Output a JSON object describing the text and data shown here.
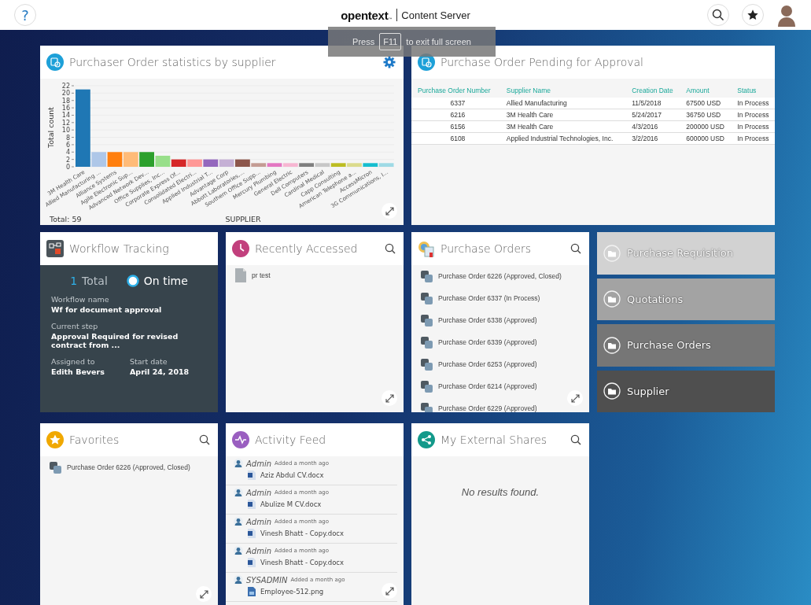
{
  "header": {
    "help": "?",
    "logo": "opentext",
    "trademark": "™",
    "product": "Content Server"
  },
  "fullscreen_notice": {
    "before": "Press",
    "key": "F11",
    "after": "to exit full screen"
  },
  "tiles": [
    {
      "kind": "chart",
      "title": "Purchaser Order statistics by supplier",
      "expand": true,
      "total": "Total: 59",
      "chart_data": {
        "type": "bar",
        "grid": true,
        "xlabel": "SUPPLIER",
        "ylabel": "Total count",
        "ylim": [
          0,
          22
        ],
        "yticks": [
          0,
          2,
          4,
          6,
          8,
          10,
          12,
          14,
          16,
          18,
          20,
          22
        ],
        "categories": [
          "3M Health Care",
          "Allied Manufacturing ...",
          "Alliance Systems",
          "Agile Electronic Sup...",
          "Advanced Network Dev...",
          "Office Supplies, Inc...",
          "Corporate Express Of...",
          "Consolidated Electri...",
          "Applied Industrial T...",
          "Advantage Corp",
          "Abbott Laboratories,...",
          "Southern Office Supp...",
          "Mercury Plumbing",
          "General Electric",
          "Dell Computers",
          "Cardinal Medical",
          "Capp Consulting",
          "American Telephone a...",
          "AccessMicron",
          "3G Communications, I..."
        ],
        "values": [
          21,
          4,
          4,
          4,
          4,
          3,
          2,
          2,
          2,
          2,
          2,
          1,
          1,
          1,
          1,
          1,
          1,
          1,
          1,
          1
        ]
      }
    },
    {
      "kind": "table",
      "title": "Purchase Order Pending for Approval",
      "columns": [
        "Purchase Order Number",
        "Supplier Name",
        "Creation Date",
        "Amount",
        "Status"
      ],
      "rows": [
        [
          "6337",
          "Allied Manufacturing",
          "11/5/2018",
          "67500 USD",
          "In Process"
        ],
        [
          "6216",
          "3M Health Care",
          "5/24/2017",
          "36750 USD",
          "In Process"
        ],
        [
          "6156",
          "3M Health Care",
          "4/3/2016",
          "200000 USD",
          "In Process"
        ],
        [
          "6108",
          "Applied Industrial Technologies, Inc.",
          "3/2/2016",
          "600000 USD",
          "In Process"
        ]
      ]
    },
    {
      "kind": "workflow",
      "title": "Workflow Tracking",
      "count": "1",
      "count_label": "Total",
      "status": "On time",
      "fields": [
        {
          "label": "Workflow name",
          "value": "Wf for document approval"
        },
        {
          "label": "Current step",
          "value": "Approval Required for revised contract from ..."
        },
        {
          "label": "Assigned to",
          "value": "Edith Bevers"
        },
        {
          "label": "Start date",
          "value": "April 24, 2018"
        }
      ]
    },
    {
      "kind": "recent",
      "title": "Recently Accessed",
      "expand": true,
      "items": [
        "pr test"
      ]
    },
    {
      "kind": "list",
      "title": "Purchase Orders",
      "expand": true,
      "items": [
        "Purchase Order 6226 (Approved, Closed)",
        "Purchase Order 6337 (In Process)",
        "Purchase Order 6338 (Approved)",
        "Purchase Order 6339 (Approved)",
        "Purchase Order 6253 (Approved)",
        "Purchase Order 6214 (Approved)",
        "Purchase Order 6229 (Approved)"
      ]
    },
    {
      "kind": "folders",
      "items": [
        {
          "label": "Purchase Requisition",
          "color": "#d2d2d2"
        },
        {
          "label": "Quotations",
          "color": "#a3a3a3"
        },
        {
          "label": "Purchase Orders",
          "color": "#767676"
        },
        {
          "label": "Supplier",
          "color": "#4f4f4f"
        }
      ]
    },
    {
      "kind": "favorites",
      "title": "Favorites",
      "expand": true,
      "items": [
        "Purchase Order 6226 (Approved, Closed)"
      ]
    },
    {
      "kind": "activity",
      "title": "Activity Feed",
      "expand": true,
      "items": [
        {
          "kind": "doc",
          "user": "Admin",
          "time": "Added a month ago",
          "file": "Aziz Abdul CV.docx"
        },
        {
          "kind": "doc",
          "user": "Admin",
          "time": "Added a month ago",
          "file": "Abulize M CV.docx"
        },
        {
          "kind": "doc",
          "user": "Admin",
          "time": "Added a month ago",
          "file": "Vinesh Bhatt - Copy.docx"
        },
        {
          "kind": "doc",
          "user": "Admin",
          "time": "Added a month ago",
          "file": "Vinesh Bhatt - Copy.docx"
        },
        {
          "kind": "image",
          "user": "SYSADMIN",
          "time": "Added a month ago",
          "file": "Employee-512.png"
        }
      ]
    },
    {
      "kind": "shares",
      "title": "My External Shares",
      "empty": "No results found."
    }
  ]
}
